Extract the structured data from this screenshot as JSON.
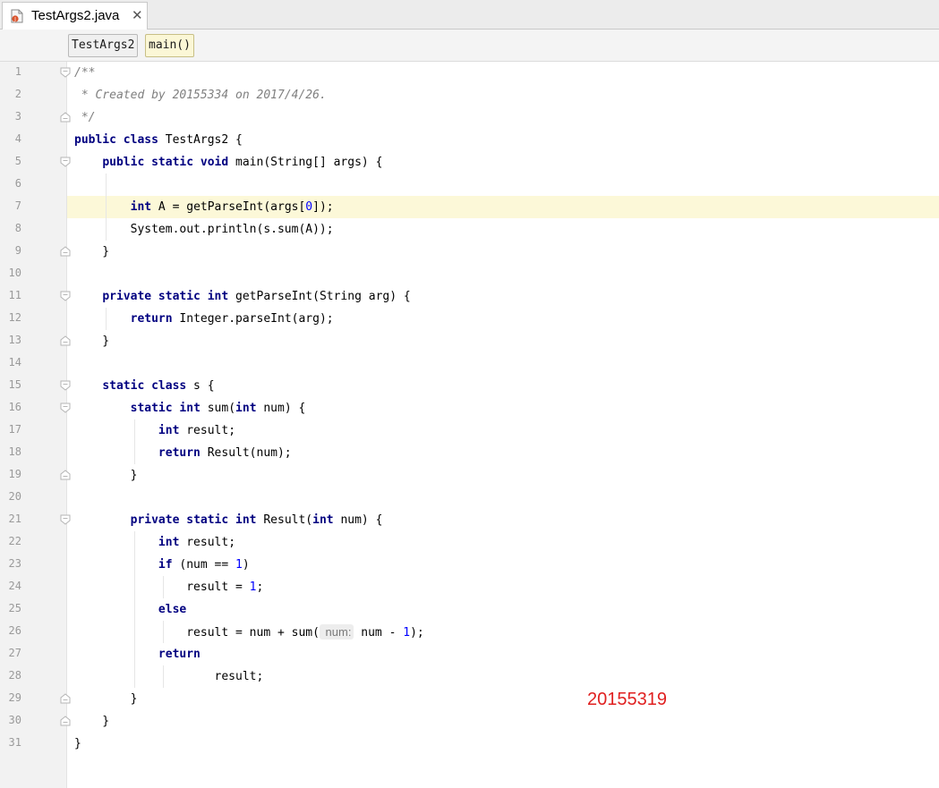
{
  "editor_tab": {
    "filename": "TestArgs2.java",
    "close_glyph": "✕"
  },
  "breadcrumbs": [
    "TestArgs2",
    "main()"
  ],
  "current_line": 7,
  "code_lines": [
    {
      "n": "1",
      "fold": "open",
      "segs": [
        [
          "cm",
          "/**"
        ]
      ]
    },
    {
      "n": "2",
      "fold": "",
      "segs": [
        [
          "cm",
          " * Created by 20155334 on 2017/4/26."
        ]
      ]
    },
    {
      "n": "3",
      "fold": "close",
      "segs": [
        [
          "cm",
          " */"
        ]
      ]
    },
    {
      "n": "4",
      "fold": "",
      "segs": [
        [
          "kw",
          "public class"
        ],
        [
          "t",
          " TestArgs2 {"
        ]
      ]
    },
    {
      "n": "5",
      "fold": "open",
      "segs": [
        [
          "t",
          "    "
        ],
        [
          "kw",
          "public static void"
        ],
        [
          "t",
          " main(String[] args) {"
        ]
      ]
    },
    {
      "n": "6",
      "fold": "",
      "segs": []
    },
    {
      "n": "7",
      "fold": "",
      "segs": [
        [
          "t",
          "        "
        ],
        [
          "kw",
          "int"
        ],
        [
          "t",
          " A = getParseInt(args["
        ],
        [
          "num",
          "0"
        ],
        [
          "t",
          "]);"
        ]
      ]
    },
    {
      "n": "8",
      "fold": "",
      "segs": [
        [
          "t",
          "        System.out.println(s.sum(A));"
        ]
      ]
    },
    {
      "n": "9",
      "fold": "close",
      "segs": [
        [
          "t",
          "    }"
        ]
      ]
    },
    {
      "n": "10",
      "fold": "",
      "segs": []
    },
    {
      "n": "11",
      "fold": "open",
      "segs": [
        [
          "t",
          "    "
        ],
        [
          "kw",
          "private static int"
        ],
        [
          "t",
          " getParseInt(String arg) {"
        ]
      ]
    },
    {
      "n": "12",
      "fold": "",
      "segs": [
        [
          "t",
          "        "
        ],
        [
          "kw",
          "return"
        ],
        [
          "t",
          " Integer.parseInt(arg);"
        ]
      ]
    },
    {
      "n": "13",
      "fold": "close",
      "segs": [
        [
          "t",
          "    }"
        ]
      ]
    },
    {
      "n": "14",
      "fold": "",
      "segs": []
    },
    {
      "n": "15",
      "fold": "open",
      "segs": [
        [
          "t",
          "    "
        ],
        [
          "kw",
          "static class"
        ],
        [
          "t",
          " s {"
        ]
      ]
    },
    {
      "n": "16",
      "fold": "open",
      "segs": [
        [
          "t",
          "        "
        ],
        [
          "kw",
          "static int"
        ],
        [
          "t",
          " sum("
        ],
        [
          "kw",
          "int"
        ],
        [
          "t",
          " num) {"
        ]
      ]
    },
    {
      "n": "17",
      "fold": "",
      "segs": [
        [
          "t",
          "            "
        ],
        [
          "kw",
          "int"
        ],
        [
          "t",
          " result;"
        ]
      ]
    },
    {
      "n": "18",
      "fold": "",
      "segs": [
        [
          "t",
          "            "
        ],
        [
          "kw",
          "return"
        ],
        [
          "t",
          " Result(num);"
        ]
      ]
    },
    {
      "n": "19",
      "fold": "close",
      "segs": [
        [
          "t",
          "        }"
        ]
      ]
    },
    {
      "n": "20",
      "fold": "",
      "segs": []
    },
    {
      "n": "21",
      "fold": "open",
      "segs": [
        [
          "t",
          "        "
        ],
        [
          "kw",
          "private static int"
        ],
        [
          "t",
          " Result("
        ],
        [
          "kw",
          "int"
        ],
        [
          "t",
          " num) {"
        ]
      ]
    },
    {
      "n": "22",
      "fold": "",
      "segs": [
        [
          "t",
          "            "
        ],
        [
          "kw",
          "int"
        ],
        [
          "t",
          " result;"
        ]
      ]
    },
    {
      "n": "23",
      "fold": "",
      "segs": [
        [
          "t",
          "            "
        ],
        [
          "kw",
          "if"
        ],
        [
          "t",
          " (num == "
        ],
        [
          "num",
          "1"
        ],
        [
          "t",
          ")"
        ]
      ]
    },
    {
      "n": "24",
      "fold": "",
      "segs": [
        [
          "t",
          "                result = "
        ],
        [
          "num",
          "1"
        ],
        [
          "t",
          ";"
        ]
      ]
    },
    {
      "n": "25",
      "fold": "",
      "segs": [
        [
          "t",
          "            "
        ],
        [
          "kw",
          "else"
        ]
      ]
    },
    {
      "n": "26",
      "fold": "",
      "segs": [
        [
          "t",
          "                result = num + sum("
        ],
        [
          "hint",
          " num:"
        ],
        [
          "t",
          " num - "
        ],
        [
          "num",
          "1"
        ],
        [
          "t",
          ");"
        ]
      ]
    },
    {
      "n": "27",
      "fold": "",
      "segs": [
        [
          "t",
          "            "
        ],
        [
          "kw",
          "return"
        ]
      ]
    },
    {
      "n": "28",
      "fold": "",
      "segs": [
        [
          "t",
          "                    result;"
        ]
      ]
    },
    {
      "n": "29",
      "fold": "close",
      "segs": [
        [
          "t",
          "        }"
        ]
      ]
    },
    {
      "n": "30",
      "fold": "close",
      "segs": [
        [
          "t",
          "    }"
        ]
      ]
    },
    {
      "n": "31",
      "fold": "",
      "segs": [
        [
          "t",
          "}"
        ]
      ]
    }
  ],
  "watermark": "20155319",
  "colors": {
    "keyword": "#000080",
    "comment": "#808080",
    "number": "#0000ff",
    "current_line": "#fcf8d8",
    "watermark": "#e02020"
  }
}
